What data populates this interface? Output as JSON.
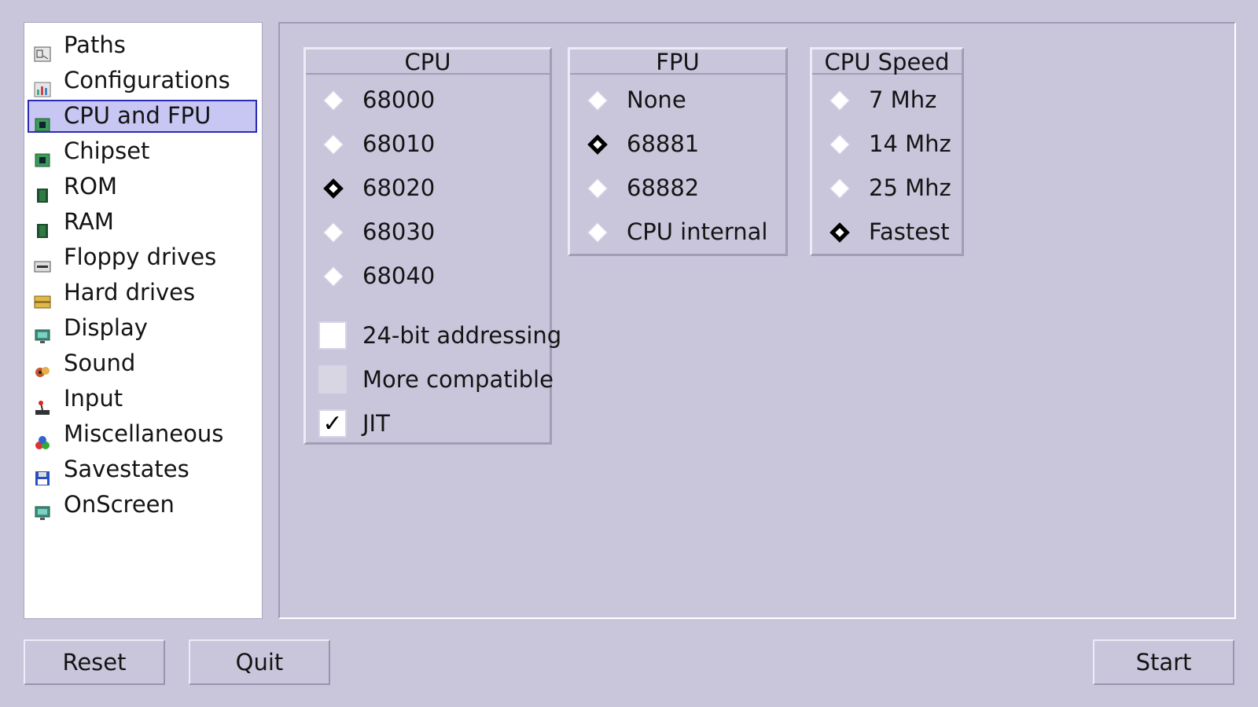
{
  "sidebar": {
    "items": [
      {
        "label": "Paths",
        "icon": "paths-icon"
      },
      {
        "label": "Configurations",
        "icon": "configurations-icon"
      },
      {
        "label": "CPU and FPU",
        "icon": "chip-icon",
        "selected": true
      },
      {
        "label": "Chipset",
        "icon": "chip-icon"
      },
      {
        "label": "ROM",
        "icon": "rom-icon"
      },
      {
        "label": "RAM",
        "icon": "ram-icon"
      },
      {
        "label": "Floppy drives",
        "icon": "floppy-drive-icon"
      },
      {
        "label": "Hard drives",
        "icon": "hard-drive-icon"
      },
      {
        "label": "Display",
        "icon": "monitor-icon"
      },
      {
        "label": "Sound",
        "icon": "sound-icon"
      },
      {
        "label": "Input",
        "icon": "joystick-icon"
      },
      {
        "label": "Miscellaneous",
        "icon": "misc-icon"
      },
      {
        "label": "Savestates",
        "icon": "floppy-disk-icon"
      },
      {
        "label": "OnScreen",
        "icon": "monitor-icon"
      }
    ]
  },
  "cpu": {
    "title": "CPU",
    "options": [
      "68000",
      "68010",
      "68020",
      "68030",
      "68040"
    ],
    "selected": "68020",
    "checkboxes": [
      {
        "label": "24-bit addressing",
        "checked": false,
        "disabled": false
      },
      {
        "label": "More compatible",
        "checked": false,
        "disabled": true
      },
      {
        "label": "JIT",
        "checked": true,
        "disabled": false
      }
    ]
  },
  "fpu": {
    "title": "FPU",
    "options": [
      "None",
      "68881",
      "68882",
      "CPU internal"
    ],
    "selected": "68881"
  },
  "speed": {
    "title": "CPU Speed",
    "options": [
      "7 Mhz",
      "14 Mhz",
      "25 Mhz",
      "Fastest"
    ],
    "selected": "Fastest"
  },
  "buttons": {
    "reset": "Reset",
    "quit": "Quit",
    "start": "Start"
  },
  "colors": {
    "background": "#c9c6dc",
    "selection_fill": "#c8c6f2",
    "selection_border": "#2b2bb3"
  }
}
